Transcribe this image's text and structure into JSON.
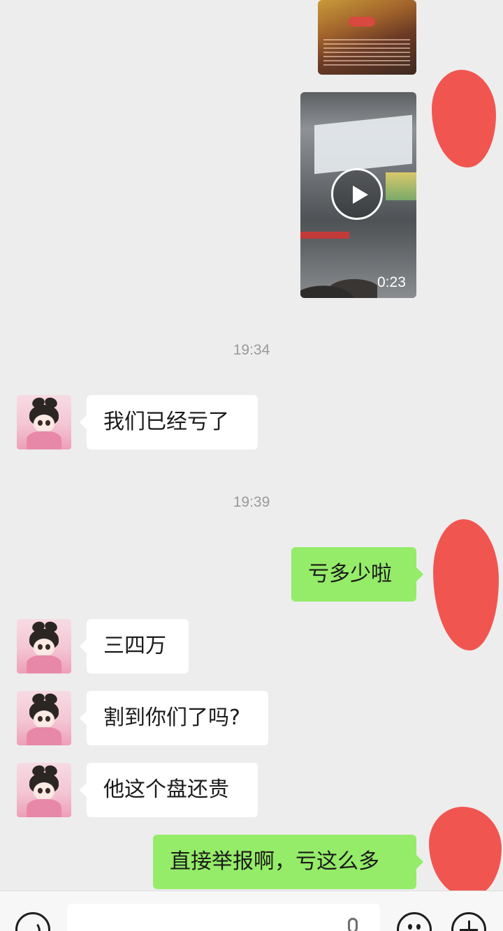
{
  "messages": {
    "video_duration": "0:23",
    "timestamp_1": "19:34",
    "msg_1": "我们已经亏了",
    "timestamp_2": "19:39",
    "msg_2": "亏多少啦",
    "msg_3": "三四万",
    "msg_4": "割到你们了吗?",
    "msg_5": "他这个盘还贵",
    "msg_6": "直接举报啊，亏这么多"
  },
  "colors": {
    "background": "#ededed",
    "incoming_bubble": "#ffffff",
    "outgoing_bubble": "#95ec69",
    "timestamp": "#9a9a9a",
    "redaction": "#f15550"
  },
  "icons": {
    "voice": "voice-icon",
    "emoji": "emoji-icon",
    "plus": "plus-icon",
    "play": "play-icon",
    "mic": "mic-icon"
  }
}
